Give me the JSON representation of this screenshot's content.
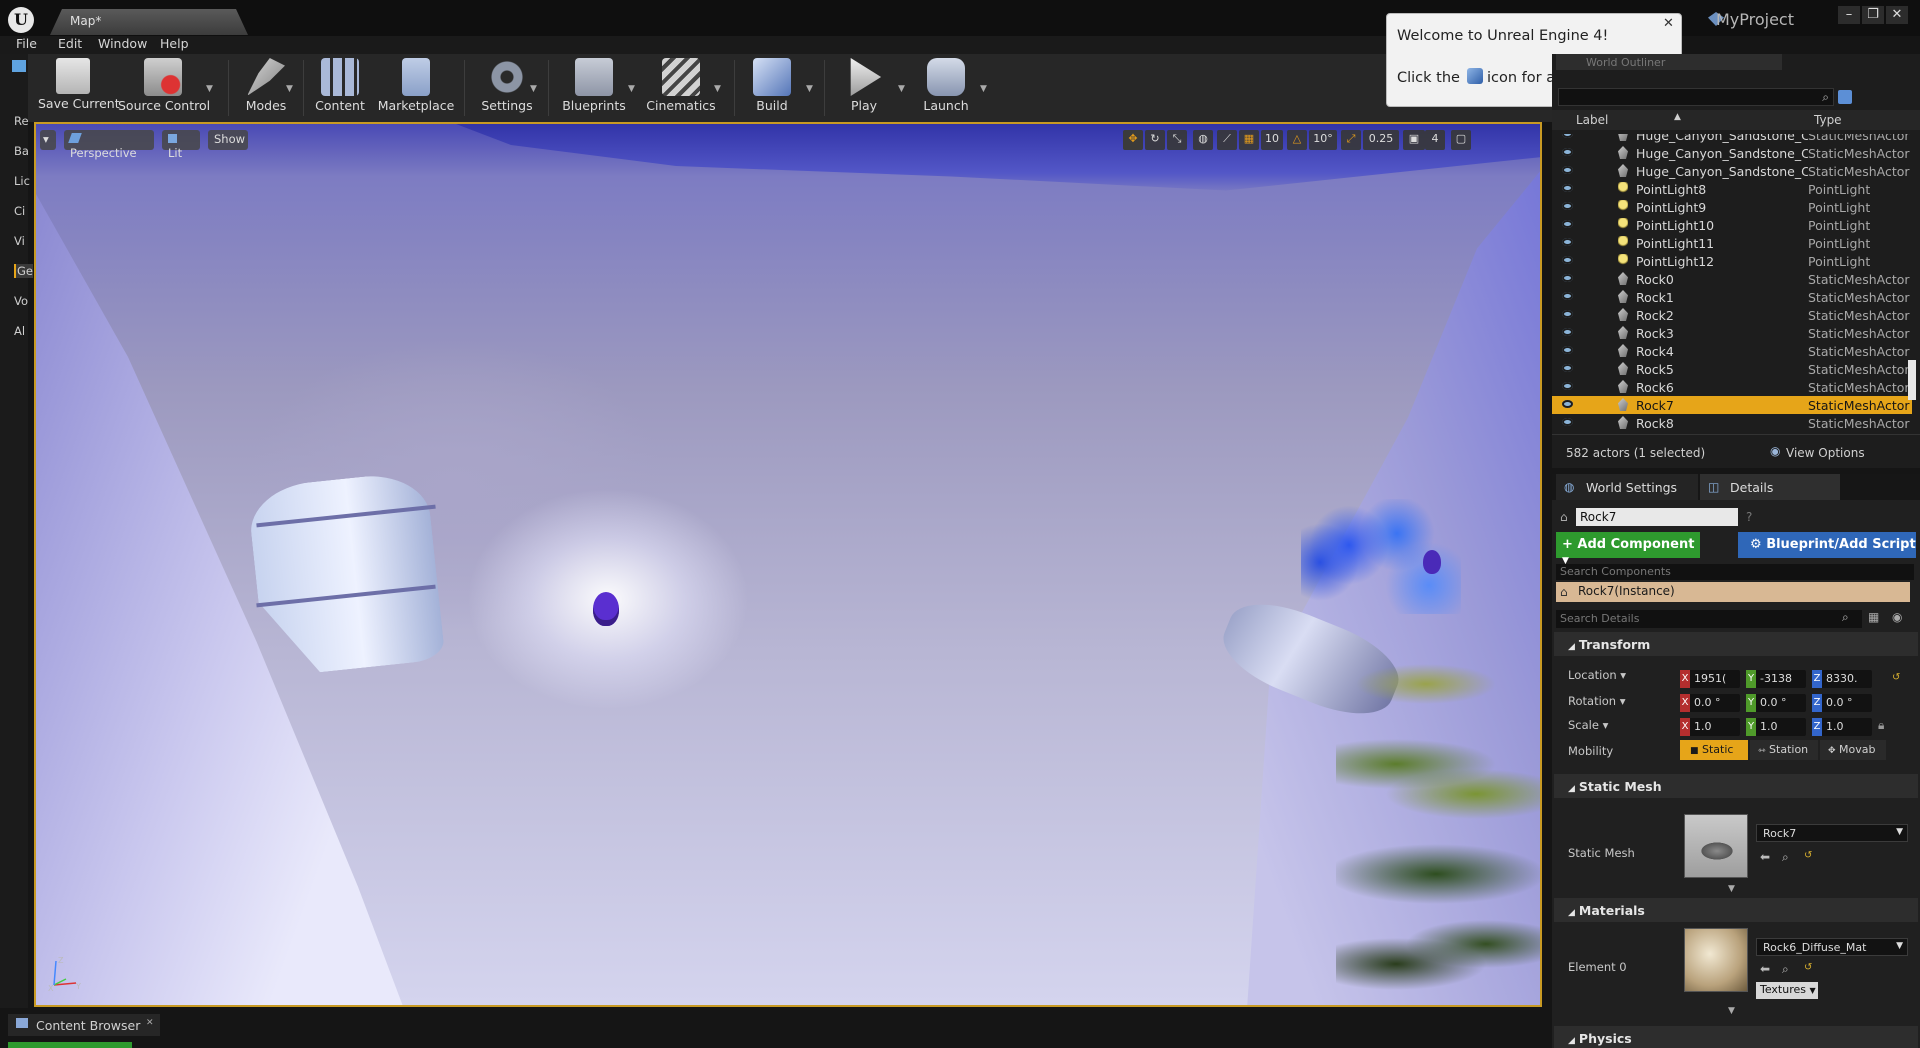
{
  "titlebar": {
    "map_tab": "Map*",
    "project": "MyProject",
    "logo": "U"
  },
  "menu": [
    "File",
    "Edit",
    "Window",
    "Help"
  ],
  "toolbar": [
    {
      "label": "Save Current",
      "icon": "save-icon",
      "color": "#dcdcdc"
    },
    {
      "label": "Source Control",
      "icon": "source-control-icon",
      "color": "#c8c8c8"
    },
    {
      "label": "Modes",
      "icon": "modes-icon",
      "color": "#bfbfbf"
    },
    {
      "label": "Content",
      "icon": "content-icon",
      "color": "#9fb1cf"
    },
    {
      "label": "Marketplace",
      "icon": "marketplace-icon",
      "color": "#9fb1cf"
    },
    {
      "label": "Settings",
      "icon": "settings-icon",
      "color": "#9aa0aa"
    },
    {
      "label": "Blueprints",
      "icon": "blueprints-icon",
      "color": "#b7bcc7"
    },
    {
      "label": "Cinematics",
      "icon": "cinematics-icon",
      "color": "#c0c0c0"
    },
    {
      "label": "Build",
      "icon": "build-icon",
      "color": "#7a9bd0"
    },
    {
      "label": "Play",
      "icon": "play-icon",
      "color": "#d9d9d9"
    },
    {
      "label": "Launch",
      "icon": "launch-icon",
      "color": "#b8c2d8"
    }
  ],
  "left_modes": [
    "Re",
    "Ba",
    "Lic",
    "Ci",
    "Vi",
    "Ge",
    "Vo",
    "Al"
  ],
  "viewport": {
    "perspective": "Perspective",
    "lit": "Lit",
    "show": "Show",
    "grid_snap": "10",
    "rot_snap": "10°",
    "scale_snap": "0.25",
    "cam_speed": "4",
    "axis_z": "Z",
    "axis_y": "Y",
    "axis_x": "X"
  },
  "welcome": {
    "title": "Welcome to Unreal Engine 4!",
    "line1": "Click the",
    "line2": "icon for a tour of the tools.",
    "close": "✕"
  },
  "outliner": {
    "tab": "World Outliner",
    "col_label": "Label",
    "col_type": "Type",
    "rows": [
      {
        "label": "Huge_Canyon_Sandstone_Cliff_l",
        "type": "StaticMeshActor",
        "icon": "static-mesh-icon",
        "selected": false
      },
      {
        "label": "Huge_Canyon_Sandstone_Cliff_l",
        "type": "StaticMeshActor",
        "icon": "static-mesh-icon",
        "selected": false
      },
      {
        "label": "Huge_Canyon_Sandstone_Cliff_l",
        "type": "StaticMeshActor",
        "icon": "static-mesh-icon",
        "selected": false
      },
      {
        "label": "PointLight8",
        "type": "PointLight",
        "icon": "point-light-icon",
        "selected": false
      },
      {
        "label": "PointLight9",
        "type": "PointLight",
        "icon": "point-light-icon",
        "selected": false
      },
      {
        "label": "PointLight10",
        "type": "PointLight",
        "icon": "point-light-icon",
        "selected": false
      },
      {
        "label": "PointLight11",
        "type": "PointLight",
        "icon": "point-light-icon",
        "selected": false
      },
      {
        "label": "PointLight12",
        "type": "PointLight",
        "icon": "point-light-icon",
        "selected": false
      },
      {
        "label": "Rock0",
        "type": "StaticMeshActor",
        "icon": "static-mesh-icon",
        "selected": false
      },
      {
        "label": "Rock1",
        "type": "StaticMeshActor",
        "icon": "static-mesh-icon",
        "selected": false
      },
      {
        "label": "Rock2",
        "type": "StaticMeshActor",
        "icon": "static-mesh-icon",
        "selected": false
      },
      {
        "label": "Rock3",
        "type": "StaticMeshActor",
        "icon": "static-mesh-icon",
        "selected": false
      },
      {
        "label": "Rock4",
        "type": "StaticMeshActor",
        "icon": "static-mesh-icon",
        "selected": false
      },
      {
        "label": "Rock5",
        "type": "StaticMeshActor",
        "icon": "static-mesh-icon",
        "selected": false
      },
      {
        "label": "Rock6",
        "type": "StaticMeshActor",
        "icon": "static-mesh-icon",
        "selected": false
      },
      {
        "label": "Rock7",
        "type": "StaticMeshActor",
        "icon": "static-mesh-icon",
        "selected": true
      },
      {
        "label": "Rock8",
        "type": "StaticMeshActor",
        "icon": "static-mesh-icon",
        "selected": false
      }
    ],
    "actor_count": "582 actors (1 selected)",
    "view_options": "View Options"
  },
  "details": {
    "tab_world": "World Settings",
    "tab_details": "Details",
    "name": "Rock7",
    "add_component": "+ Add Component",
    "blueprint_script": "Blueprint/Add Script",
    "search_components": "Search Components",
    "component_instance": "Rock7(Instance)",
    "search_details": "Search Details",
    "transform": "Transform",
    "location_label": "Location",
    "rotation_label": "Rotation",
    "scale_label": "Scale",
    "mobility_label": "Mobility",
    "location": [
      "1951(",
      "-3138",
      "8330."
    ],
    "rotation": [
      "0.0 °",
      "0.0 °",
      "0.0 °"
    ],
    "scale": [
      "1.0",
      "1.0",
      "1.0"
    ],
    "mobility": [
      "Static",
      "Station",
      "Movab"
    ],
    "static_mesh_section": "Static Mesh",
    "static_mesh_label": "Static Mesh",
    "static_mesh_value": "Rock7",
    "materials_section": "Materials",
    "element0_label": "Element 0",
    "material_value": "Rock6_Diffuse_Mat",
    "textures_btn": "Textures",
    "physics_section": "Physics"
  },
  "content_browser": {
    "tab": "Content Browser"
  },
  "colors": {
    "accent": "#e6a519",
    "add_component": "#2e9a2e",
    "blueprint": "#2f67b8",
    "x": "#b42e2e",
    "y": "#4f9a2a",
    "z": "#3366cc"
  }
}
